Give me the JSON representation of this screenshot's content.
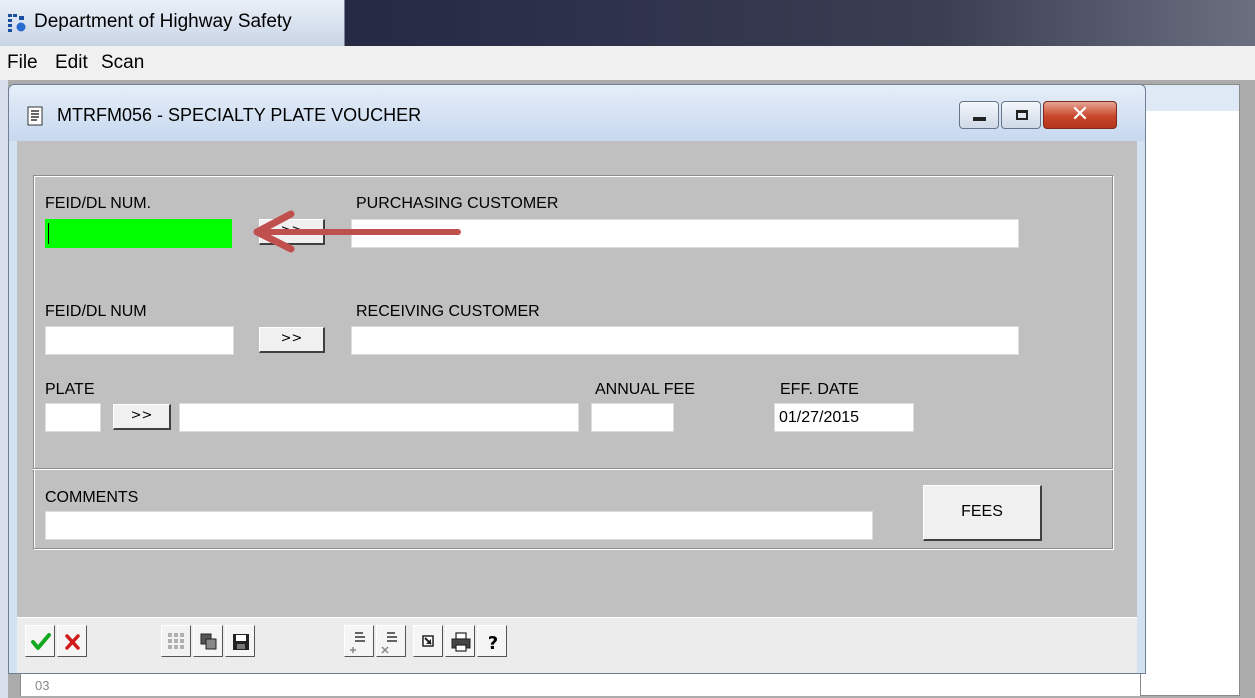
{
  "app": {
    "title": "Department of Highway Safety",
    "menu": [
      "File",
      "Edit",
      "Scan"
    ],
    "behind_window_text": "03"
  },
  "child_window": {
    "title": "MTRFM056 - SPECIALTY PLATE VOUCHER"
  },
  "form": {
    "purchasing": {
      "id_label": "FEID/DL NUM.",
      "id_value": "",
      "lookup_label": ">>",
      "customer_label": "PURCHASING CUSTOMER",
      "customer_value": ""
    },
    "receiving": {
      "id_label": "FEID/DL NUM",
      "id_value": "",
      "lookup_label": ">>",
      "customer_label": "RECEIVING CUSTOMER",
      "customer_value": ""
    },
    "plate": {
      "label": "PLATE",
      "code_value": "",
      "lookup_label": ">>",
      "description_value": ""
    },
    "annual_fee": {
      "label": "ANNUAL FEE",
      "value": ""
    },
    "eff_date": {
      "label": "EFF. DATE",
      "value": "01/27/2015"
    },
    "comments": {
      "label": "COMMENTS",
      "value": ""
    },
    "fees_button_label": "FEES"
  },
  "colors": {
    "focused_field": "#00ff00",
    "annotation_arrow": "#c0504d"
  },
  "toolbar": {
    "buttons": [
      "check-icon",
      "cancel-x-icon",
      "grid-icon",
      "restore-windows-icon",
      "save-disk-icon",
      "insert-row-icon",
      "delete-row-icon",
      "jump-icon",
      "print-icon",
      "help-icon"
    ]
  }
}
